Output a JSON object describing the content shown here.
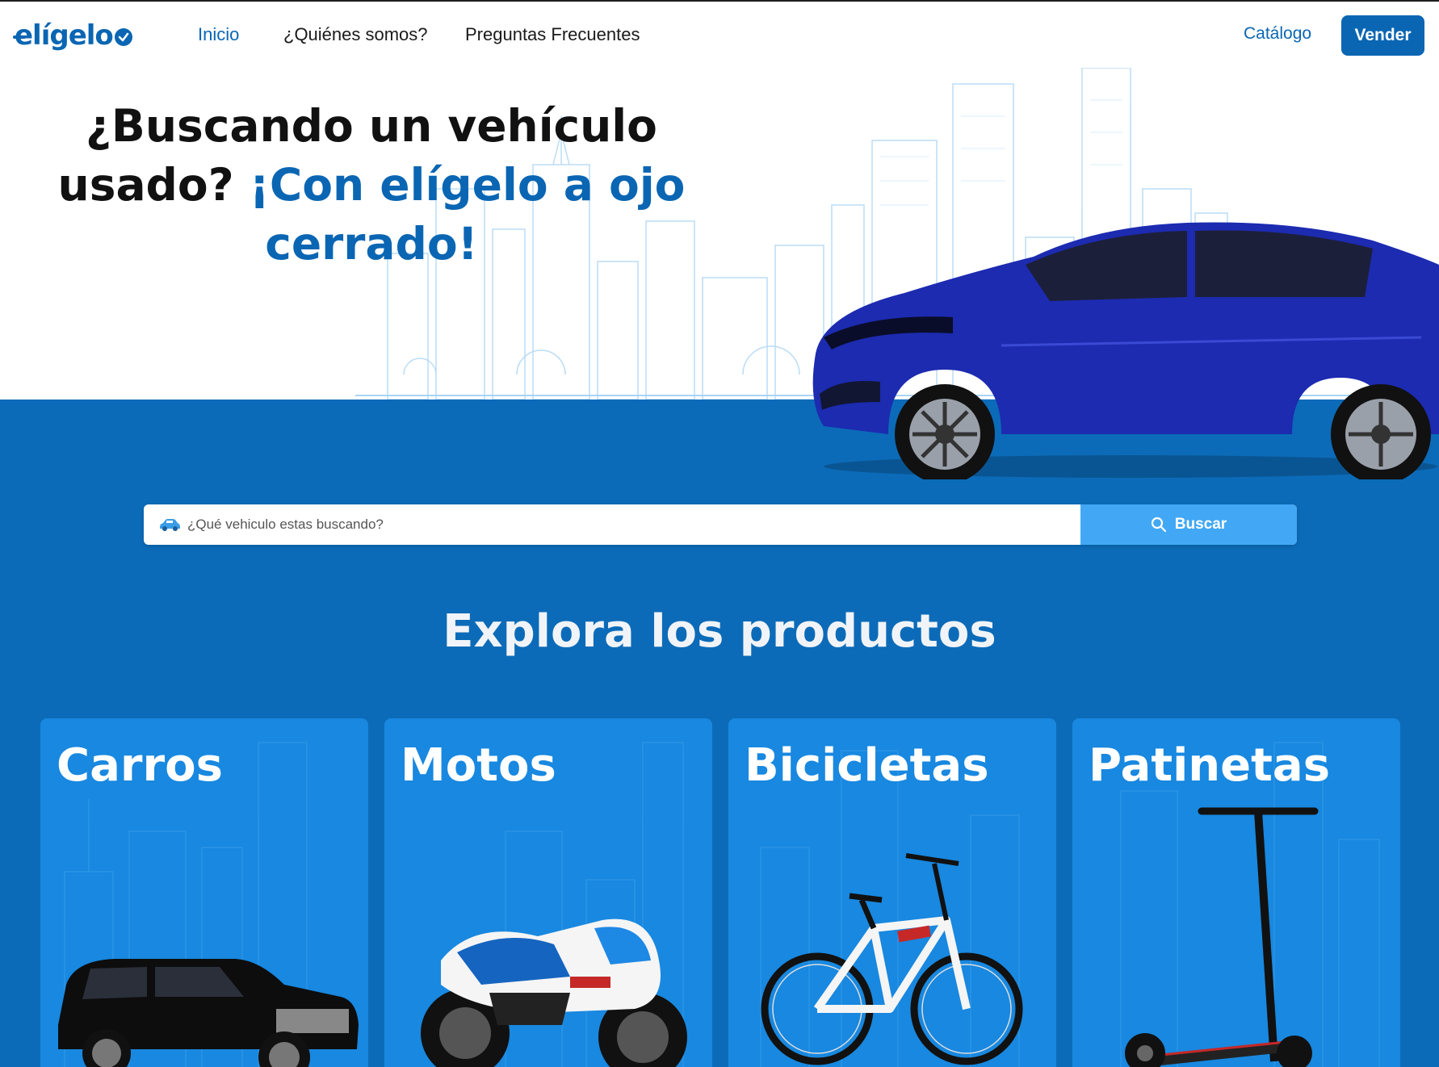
{
  "brand": {
    "logo": "elígelo"
  },
  "nav": {
    "links": [
      {
        "label": "Inicio",
        "active": true
      },
      {
        "label": "¿Quiénes somos?",
        "active": false
      },
      {
        "label": "Preguntas Frecuentes",
        "active": false
      }
    ],
    "catalogo": "Catálogo",
    "vender": "Vender"
  },
  "hero": {
    "title_part1": "¿Buscando un vehículo usado?",
    "title_part2": "¡Con elígelo a ojo cerrado!"
  },
  "search": {
    "placeholder": "¿Qué vehiculo estas buscando?",
    "button": "Buscar",
    "car_icon": "car-icon",
    "search_icon": "search-icon"
  },
  "products": {
    "heading": "Explora los productos",
    "cards": [
      {
        "title": "Carros",
        "image": "suv-black"
      },
      {
        "title": "Motos",
        "image": "sport-motorcycle"
      },
      {
        "title": "Bicicletas",
        "image": "mountain-bike"
      },
      {
        "title": "Patinetas",
        "image": "electric-scooter"
      }
    ]
  },
  "colors": {
    "brand_blue": "#0a66b3",
    "hero_blue": "#0c6bb8",
    "card_blue": "#1888e0",
    "search_button": "#42a8f5"
  }
}
